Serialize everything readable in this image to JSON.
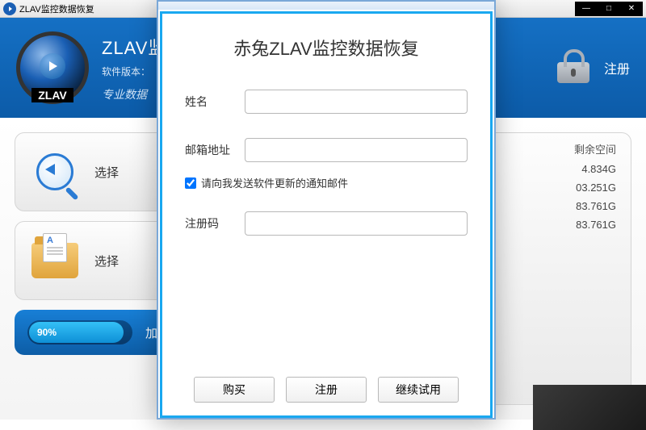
{
  "window": {
    "title": "ZLAV监控数据恢复"
  },
  "header": {
    "logo_text": "ZLAV",
    "title_prefix": "ZLAV监",
    "version_prefix": "软件版本：",
    "script_text": "专业数据",
    "register_label": "注册"
  },
  "cards": {
    "select_disk": "选择",
    "select_folder": "选择",
    "load_label": "加载"
  },
  "progress": {
    "percent": "90%",
    "width_pct": 90
  },
  "right": {
    "col_head": "剩余空间",
    "rows": [
      "4.834G",
      "03.251G",
      "83.761G",
      "83.761G"
    ]
  },
  "modal": {
    "title": "赤兔ZLAV监控数据恢复",
    "name_label": "姓名",
    "email_label": "邮箱地址",
    "newsletter_label": "请向我发送软件更新的通知邮件",
    "newsletter_checked": true,
    "code_label": "注册码",
    "buy_btn": "购买",
    "register_btn": "注册",
    "trial_btn": "继续试用"
  }
}
